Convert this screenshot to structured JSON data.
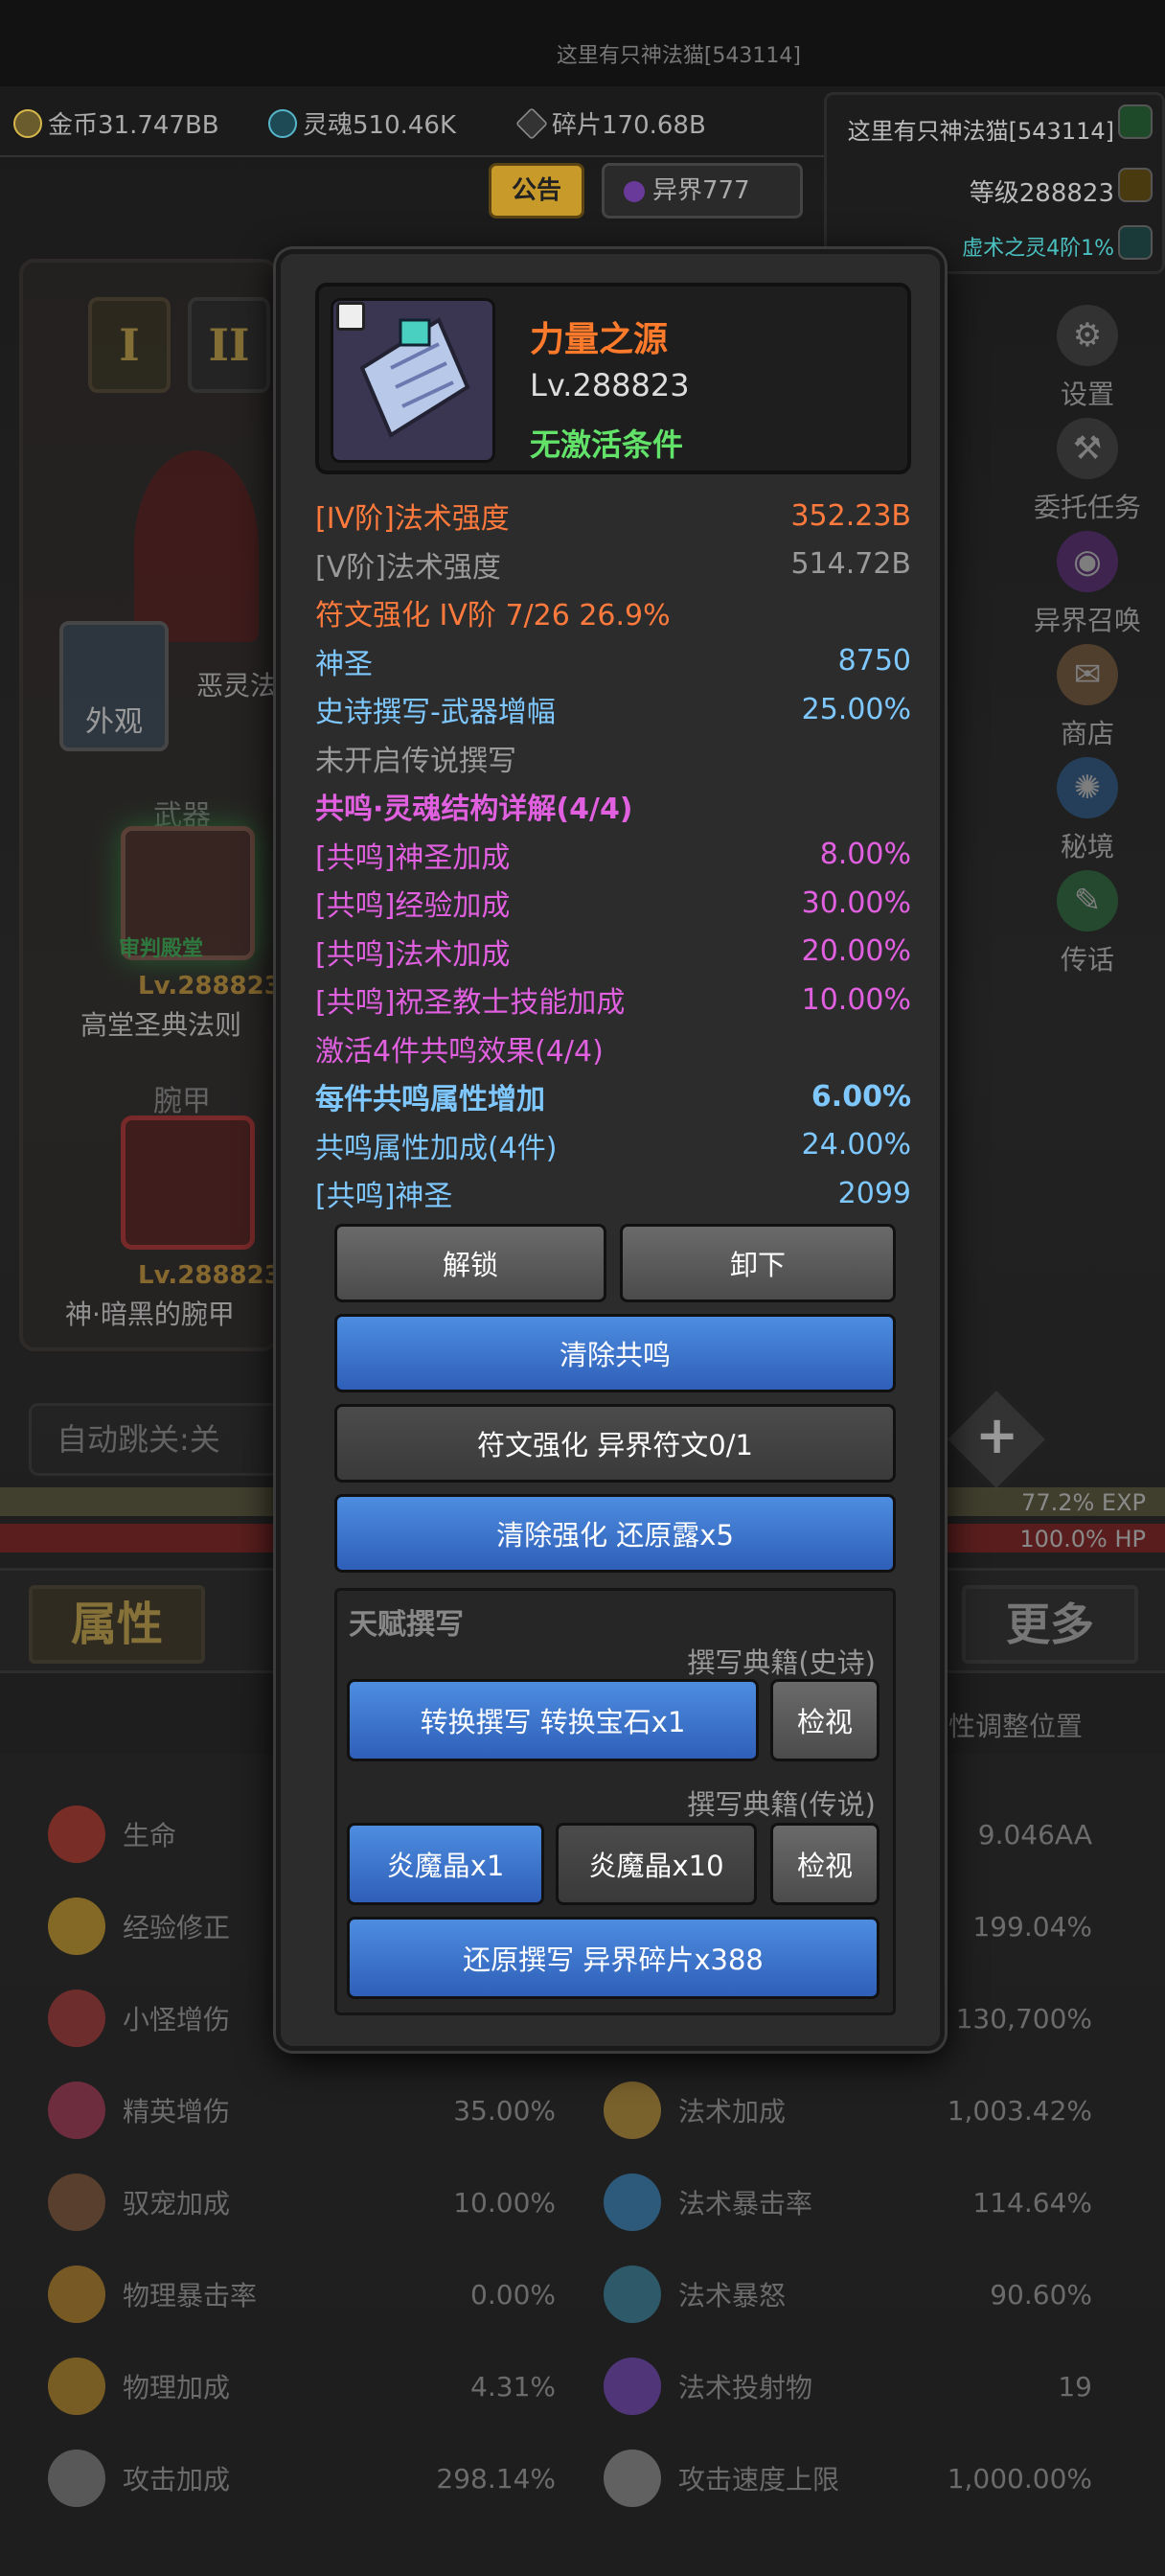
{
  "top_notice": "这里有只神法猫[543114]",
  "currency": [
    {
      "icon": "coin-icon",
      "label": "金币31.747BB",
      "color": "#d6b74a"
    },
    {
      "icon": "soul-icon",
      "label": "灵魂510.46K",
      "color": "#56b6c9"
    },
    {
      "icon": "shard-icon",
      "label": "碎片170.68B",
      "color": "#8a8a8a"
    }
  ],
  "buttons_top": {
    "notice": "公告",
    "otherworld": "异界777"
  },
  "player": {
    "name": "这里有只神法猫[543114]",
    "level": "等级288823",
    "realm": "虚术之灵4阶1%"
  },
  "left": {
    "tab1": "I",
    "tab2": "II",
    "appearance": "外观",
    "char_name": "恶灵法",
    "weapon_hdr": "武器",
    "weapon_tag": "审判殿堂",
    "weapon_lv": "Lv.288823",
    "weapon_name": "高堂圣典法则",
    "armor_hdr": "腕甲",
    "armor_lv": "Lv.288823",
    "armor_name": "神·暗黑的腕甲",
    "autoskip": "自动跳关:关"
  },
  "right_menu": [
    "设置",
    "委托任务",
    "异界召唤",
    "商店",
    "秘境",
    "传话"
  ],
  "bars": {
    "exp": "77.2% EXP",
    "hp": "100.0% HP"
  },
  "bottom_tabs": {
    "attr": "属性",
    "more": "更多",
    "hint": "性调整位置"
  },
  "stats": [
    {
      "icon": "heart-icon",
      "name": "生命",
      "value": "",
      "color": "#c0392b"
    },
    {
      "icon": "crown-icon",
      "name": "经验修正",
      "value": "",
      "color": "#d4a62a"
    },
    {
      "icon": "demon-icon",
      "name": "小怪增伤",
      "value": "",
      "color": "#b03a3a"
    },
    {
      "icon": "helmet-icon",
      "name": "精英增伤",
      "value": "35.00%",
      "color": "#b03a5a"
    },
    {
      "icon": "paw-icon",
      "name": "驭宠加成",
      "value": "10.00%",
      "color": "#8a5a3a"
    },
    {
      "icon": "crit-icon",
      "name": "物理暴击率",
      "value": "0.00%",
      "color": "#c08a2a"
    },
    {
      "icon": "sword-icon",
      "name": "物理加成",
      "value": "4.31%",
      "color": "#c0902a"
    },
    {
      "icon": "swords-icon",
      "name": "攻击加成",
      "value": "298.14%",
      "color": "#999"
    }
  ],
  "stats_right": [
    {
      "icon": "",
      "name": "",
      "value": "9.046AA"
    },
    {
      "icon": "",
      "name": "",
      "value": "199.04%"
    },
    {
      "icon": "",
      "name": "",
      "value": "130,700%"
    },
    {
      "icon": "magic-icon",
      "name": "法术加成",
      "value": "1,003.42%",
      "color": "#c59a3a"
    },
    {
      "icon": "magic-crit-icon",
      "name": "法术暴击率",
      "value": "114.64%",
      "color": "#3a8ac5"
    },
    {
      "icon": "magic-rage-icon",
      "name": "法术暴怒",
      "value": "90.60%",
      "color": "#3a8aa5"
    },
    {
      "icon": "projectile-icon",
      "name": "法术投射物",
      "value": "19",
      "color": "#7a4ac5"
    },
    {
      "icon": "speed-icon",
      "name": "攻击速度上限",
      "value": "1,000.00%",
      "color": "#aaa"
    }
  ],
  "modal": {
    "title": "力量之源",
    "level": "Lv.288823",
    "condition": "无激活条件",
    "rows": [
      {
        "label": "[IV阶]法术强度",
        "value": "352.23B",
        "cls": "c-orange"
      },
      {
        "label": "[V阶]法术强度",
        "value": "514.72B",
        "cls": "c-gray"
      },
      {
        "label": "符文强化 IV阶 7/26 26.9%",
        "value": "",
        "cls": "c-orange"
      },
      {
        "label": "神圣",
        "value": "8750",
        "cls": "c-blue"
      },
      {
        "label": "史诗撰写-武器增幅",
        "value": "25.00%",
        "cls": "c-blue"
      },
      {
        "label": "未开启传说撰写",
        "value": "",
        "cls": "c-gray"
      },
      {
        "label": "共鸣·灵魂结构详解(4/4)",
        "value": "",
        "cls": "c-pink c-bold"
      },
      {
        "label": "[共鸣]神圣加成",
        "value": "8.00%",
        "cls": "c-pink"
      },
      {
        "label": "[共鸣]经验加成",
        "value": "30.00%",
        "cls": "c-pink"
      },
      {
        "label": "[共鸣]法术加成",
        "value": "20.00%",
        "cls": "c-pink"
      },
      {
        "label": "[共鸣]祝圣教士技能加成",
        "value": "10.00%",
        "cls": "c-pink"
      },
      {
        "label": "激活4件共鸣效果(4/4)",
        "value": "",
        "cls": "c-pink"
      },
      {
        "label": "每件共鸣属性增加",
        "value": "6.00%",
        "cls": "c-blue c-bold"
      },
      {
        "label": "共鸣属性加成(4件)",
        "value": "24.00%",
        "cls": "c-blue"
      },
      {
        "label": "[共鸣]神圣",
        "value": "2099",
        "cls": "c-blue"
      }
    ],
    "btn_unlock": "解锁",
    "btn_unequip": "卸下",
    "btn_clear_res": "清除共鸣",
    "btn_rune": "符文强化 异界符文0/1",
    "btn_clear_enh": "清除强化 还原露x5",
    "talent": {
      "title": "天赋撰写",
      "epic_hdr": "撰写典籍(史诗)",
      "btn_convert": "转换撰写 转换宝石x1",
      "btn_view1": "检视",
      "legend_hdr": "撰写典籍(传说)",
      "btn_crystal1": "炎魔晶x1",
      "btn_crystal10": "炎魔晶x10",
      "btn_view2": "检视",
      "btn_restore": "还原撰写 异界碎片x388"
    }
  }
}
